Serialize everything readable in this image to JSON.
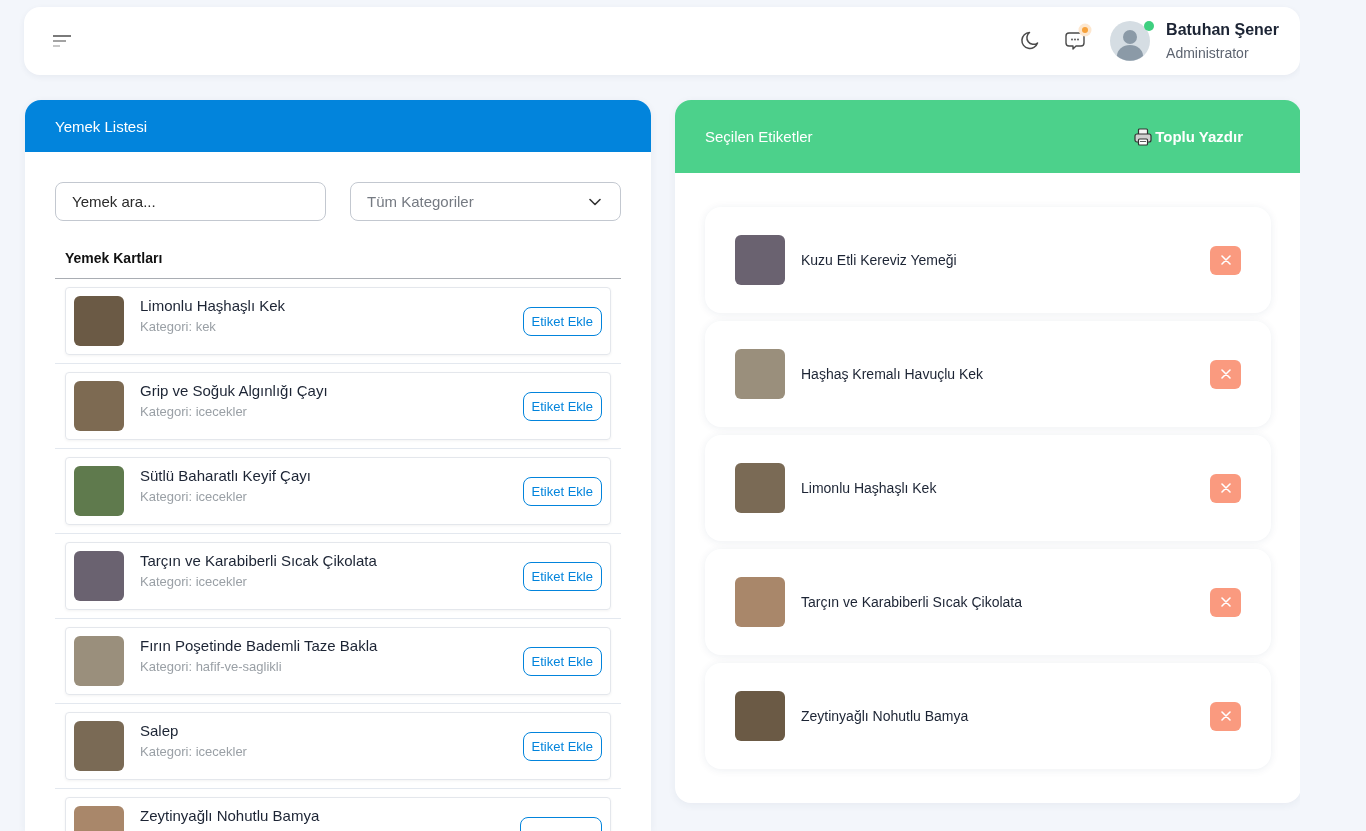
{
  "header": {
    "notifications": {
      "unread": true
    },
    "user": {
      "name": "Batuhan Şener",
      "role": "Administrator",
      "online": true
    }
  },
  "food_list": {
    "title": "Yemek Listesi",
    "search": {
      "placeholder": "Yemek ara..."
    },
    "category_filter": {
      "value": "Tüm Kategoriler"
    },
    "section_title": "Yemek Kartları",
    "items": [
      {
        "name": "Limonlu Haşhaşlı Kek",
        "category": "Kategori: kek",
        "action": "Etiket Ekle"
      },
      {
        "name": "Grip ve Soğuk Algınlığı Çayı",
        "category": "Kategori: icecekler",
        "action": "Etiket Ekle"
      },
      {
        "name": "Sütlü Baharatlı Keyif Çayı",
        "category": "Kategori: icecekler",
        "action": "Etiket Ekle"
      },
      {
        "name": "Tarçın ve Karabiberli Sıcak Çikolata",
        "category": "Kategori: icecekler",
        "action": "Etiket Ekle"
      },
      {
        "name": "Fırın Poşetinde Bademli Taze Bakla",
        "category": "Kategori: hafif-ve-saglikli",
        "action": "Etiket Ekle"
      },
      {
        "name": "Salep",
        "category": "Kategori: icecekler",
        "action": "Etiket Ekle"
      },
      {
        "name": "Zeytinyağlı Nohutlu Bamya"
      }
    ]
  },
  "selected_labels": {
    "title": "Seçilen Etiketler",
    "print_action": "Toplu Yazdır",
    "items": [
      {
        "name": "Kuzu Etli Kereviz Yemeği"
      },
      {
        "name": "Haşhaş Kremalı Havuçlu Kek"
      },
      {
        "name": "Limonlu Haşhaşlı Kek"
      },
      {
        "name": "Tarçın ve Karabiberli Sıcak Çikolata"
      },
      {
        "name": "Zeytinyağlı Nohutlu Bamya"
      }
    ]
  }
}
